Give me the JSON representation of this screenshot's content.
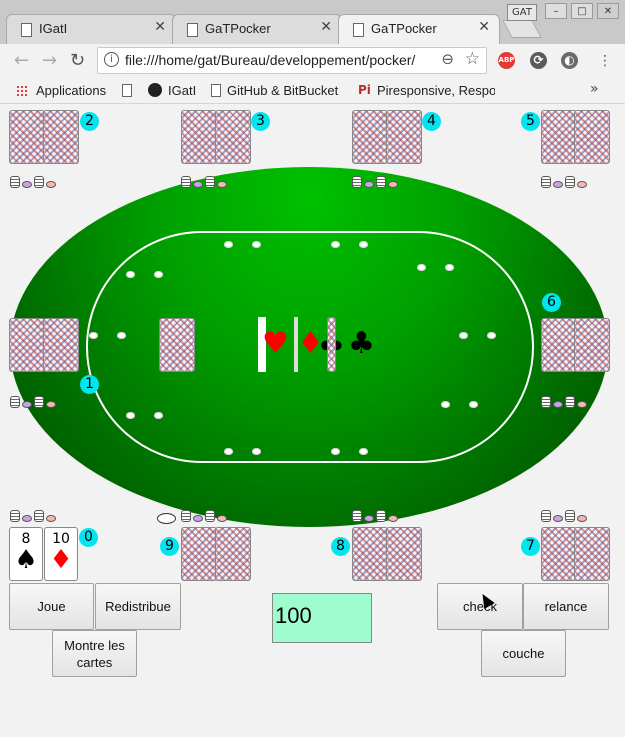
{
  "browser": {
    "tabs": [
      {
        "title": "IGatI",
        "close": "✕"
      },
      {
        "title": "GaTPocker",
        "close": "✕"
      },
      {
        "title": "GaTPocker",
        "close": "✕"
      }
    ],
    "profile_badge": "GAT",
    "window_controls": {
      "minimize": "–",
      "maximize": "□",
      "close": "✕"
    },
    "url": "file:///home/gat/Bureau/developpement/pocker/",
    "bookmarks": [
      {
        "label": "Applications"
      },
      {
        "label": "IGatI"
      },
      {
        "label": "GitHub & BitBucket"
      },
      {
        "label": "Piresponsive, Respo"
      }
    ],
    "extensions": [
      {
        "name": "abp",
        "label": "ABP",
        "color": "#e53935"
      },
      {
        "name": "sync",
        "label": "⟳",
        "color": "#5a5a5a"
      },
      {
        "name": "profile",
        "label": "◐",
        "color": "#6a6a6a"
      }
    ]
  },
  "game": {
    "seats": [
      {
        "number": "0"
      },
      {
        "number": "1"
      },
      {
        "number": "2"
      },
      {
        "number": "3"
      },
      {
        "number": "4"
      },
      {
        "number": "5"
      },
      {
        "number": "6"
      },
      {
        "number": "7"
      },
      {
        "number": "8"
      },
      {
        "number": "9"
      }
    ],
    "hand": [
      {
        "rank": "8",
        "suit": "♠",
        "color": "#000000"
      },
      {
        "rank": "10",
        "suit": "♦",
        "color": "#ff0000"
      }
    ],
    "board_suits": [
      {
        "suit": "♥",
        "color": "#ff0000"
      },
      {
        "suit": "♦",
        "color": "#ff0000"
      },
      {
        "suit": "♣",
        "color": "#000000"
      },
      {
        "suit": "♣",
        "color": "#000000"
      }
    ],
    "bet_amount": "100",
    "buttons": {
      "joue": "Joue",
      "redistribue": "Redistribue",
      "montre": "Montre les cartes",
      "check": "check",
      "relance": "relance",
      "couche": "couche"
    },
    "colors": {
      "table_green": "#00a000",
      "badge_cyan": "#00e5ee",
      "bet_field": "#9ffccf"
    }
  }
}
